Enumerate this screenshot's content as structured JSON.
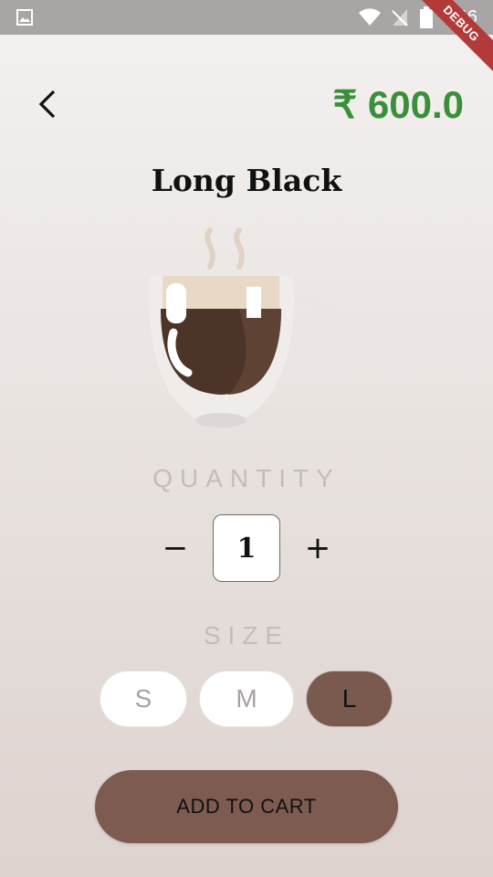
{
  "status_bar": {
    "time": "4:46",
    "icons": [
      "photo-icon",
      "wifi-icon",
      "no-signal-icon",
      "battery-icon"
    ]
  },
  "debug_banner": "DEBUG",
  "header": {
    "back_icon": "chevron-left-icon",
    "price": "₹ 600.0"
  },
  "product": {
    "name": "Long Black",
    "image": "coffee-cup-icon"
  },
  "quantity": {
    "label": "QUANTITY",
    "decrement": "−",
    "value": "1",
    "increment": "+"
  },
  "size": {
    "label": "SIZE",
    "options": [
      "S",
      "M",
      "L"
    ],
    "selected": "L"
  },
  "cart_button": {
    "label": "ADD TO CART"
  },
  "colors": {
    "price": "#3a8f3a",
    "accent_brown": "#7e5b50",
    "label_gray": "#c3bcba",
    "status_bar": "#a8a6a5",
    "debug_banner": "#b23a3a"
  }
}
